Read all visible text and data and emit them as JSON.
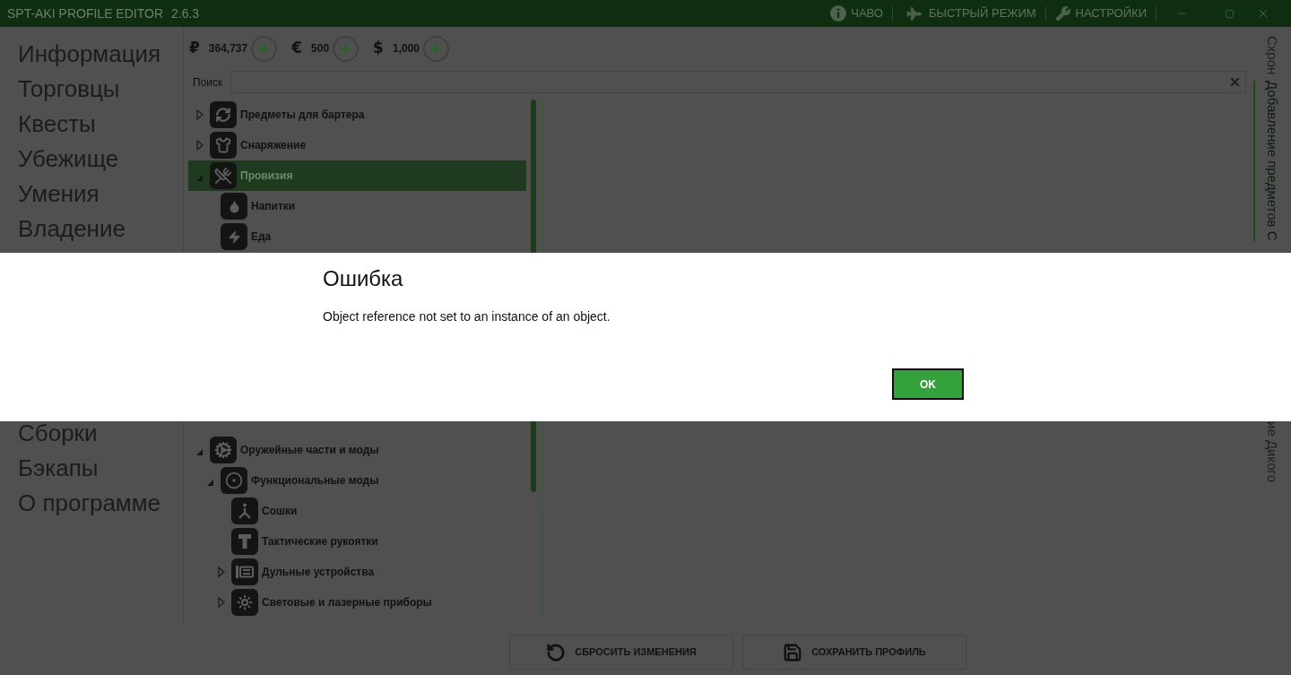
{
  "window": {
    "title": "SPT-AKI PROFILE EDITOR",
    "version": "2.6.3",
    "actions": [
      {
        "kind": "info",
        "label": "ЧАВО"
      },
      {
        "kind": "plane",
        "label": "БЫСТРЫЙ РЕЖИМ"
      },
      {
        "kind": "wrench",
        "label": "НАСТРОЙКИ"
      }
    ]
  },
  "sidebar": {
    "items": [
      {
        "label": "Информация"
      },
      {
        "label": "Торговцы"
      },
      {
        "label": "Квесты"
      },
      {
        "label": "Убежище"
      },
      {
        "label": "Умения"
      },
      {
        "label": "Владение"
      }
    ],
    "items_below_dialog": [
      {
        "label": "Сборки"
      },
      {
        "label": "Бэкапы"
      },
      {
        "label": "О программе"
      }
    ]
  },
  "currencies": [
    {
      "symbol": "₽",
      "amount": "364,737"
    },
    {
      "symbol": "€",
      "amount": "500"
    },
    {
      "symbol": "$",
      "amount": "1,000"
    }
  ],
  "search": {
    "label": "Поиск"
  },
  "tree": {
    "items": [
      {
        "kind": "barter",
        "label": "Предметы для бартера",
        "expanded": false,
        "selected": false
      },
      {
        "kind": "gear",
        "label": "Снаряжение",
        "expanded": false,
        "selected": false
      },
      {
        "kind": "provisions",
        "label": "Провизия",
        "expanded": true,
        "selected": true,
        "children": [
          {
            "kind": "drinks",
            "label": "Напитки",
            "selected": false
          },
          {
            "kind": "food",
            "label": "Еда",
            "selected": false
          }
        ]
      }
    ],
    "items_below_dialog": [
      {
        "kind": "weaponparts",
        "label": "Оружейные части и моды",
        "expanded": true,
        "selected": false,
        "children": [
          {
            "kind": "functional",
            "label": "Функциональные моды",
            "expanded": true,
            "selected": false,
            "children": [
              {
                "kind": "bipods",
                "label": "Сошки",
                "selected": false
              },
              {
                "kind": "grips",
                "label": "Тактические рукоятки",
                "selected": false
              },
              {
                "kind": "muzzle",
                "label": "Дульные устройства",
                "expanded": false,
                "selected": false
              },
              {
                "kind": "lights",
                "label": "Световые и лазерные приборы",
                "expanded": false,
                "selected": false
              }
            ]
          }
        ]
      }
    ]
  },
  "right_tabs": [
    {
      "label": "Схрон",
      "selected": false
    },
    {
      "label": "Добавление предметов С",
      "selected": true
    }
  ],
  "right_tabs_below_dialog": [
    {
      "label": "ие Дикого",
      "selected": false
    }
  ],
  "buttons": [
    {
      "kind": "reset",
      "label": "СБРОСИТЬ ИЗМЕНЕНИЯ"
    },
    {
      "kind": "save",
      "label": "СОХРАНИТЬ ПРОФИЛЬ"
    }
  ],
  "dialog": {
    "title": "Ошибка",
    "message": "Object reference not set to an instance of an object.",
    "button": "OK"
  }
}
